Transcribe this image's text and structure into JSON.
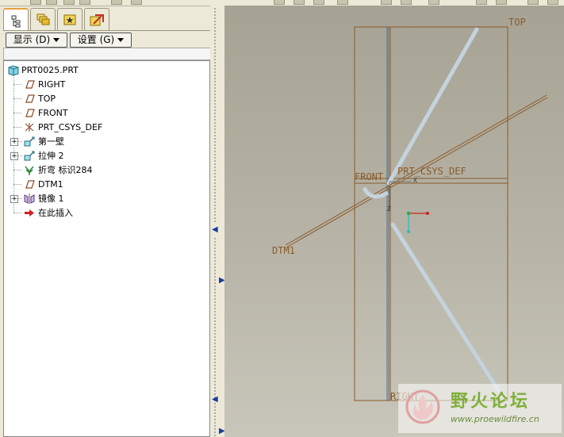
{
  "nav_tabs": [
    {
      "name": "model-tree-tab",
      "icon": "model-tree-icon"
    },
    {
      "name": "layers-tab",
      "icon": "layers-icon"
    },
    {
      "name": "favorites-tab",
      "icon": "favorites-icon"
    },
    {
      "name": "connections-tab",
      "icon": "connections-icon"
    }
  ],
  "controls": {
    "show_label": "显示 (D)",
    "settings_label": "设置 (G)"
  },
  "tree": {
    "root": "PRT0025.PRT",
    "items": [
      {
        "label": "RIGHT",
        "icon": "datum-plane-icon"
      },
      {
        "label": "TOP",
        "icon": "datum-plane-icon"
      },
      {
        "label": "FRONT",
        "icon": "datum-plane-icon"
      },
      {
        "label": "PRT_CSYS_DEF",
        "icon": "coordinate-system-icon"
      },
      {
        "label": "第一壁",
        "icon": "sheetmetal-wall-icon",
        "expandable": true
      },
      {
        "label": "拉伸 2",
        "icon": "extrude-icon",
        "expandable": true
      },
      {
        "label": "折弯 标识284",
        "icon": "bend-icon"
      },
      {
        "label": "DTM1",
        "icon": "datum-plane-icon"
      },
      {
        "label": "镜像 1",
        "icon": "mirror-icon",
        "expandable": true
      },
      {
        "label": "在此插入",
        "icon": "insert-here-arrow-icon"
      }
    ]
  },
  "viewport": {
    "labels": {
      "top": "TOP",
      "front": "FRONT",
      "csys": "PRT_CSYS_DEF",
      "dtm1": "DTM1",
      "right": "RIGHT",
      "x_axis": "X",
      "z_axis": "Z"
    },
    "colors": {
      "datum": "#8a5a2a",
      "part": "#c4d3dd",
      "background_top": "#a6a394",
      "background_bottom": "#c8c6ba"
    }
  },
  "watermark": {
    "title": "野火论坛",
    "url": "www.proewildfire.cn"
  }
}
